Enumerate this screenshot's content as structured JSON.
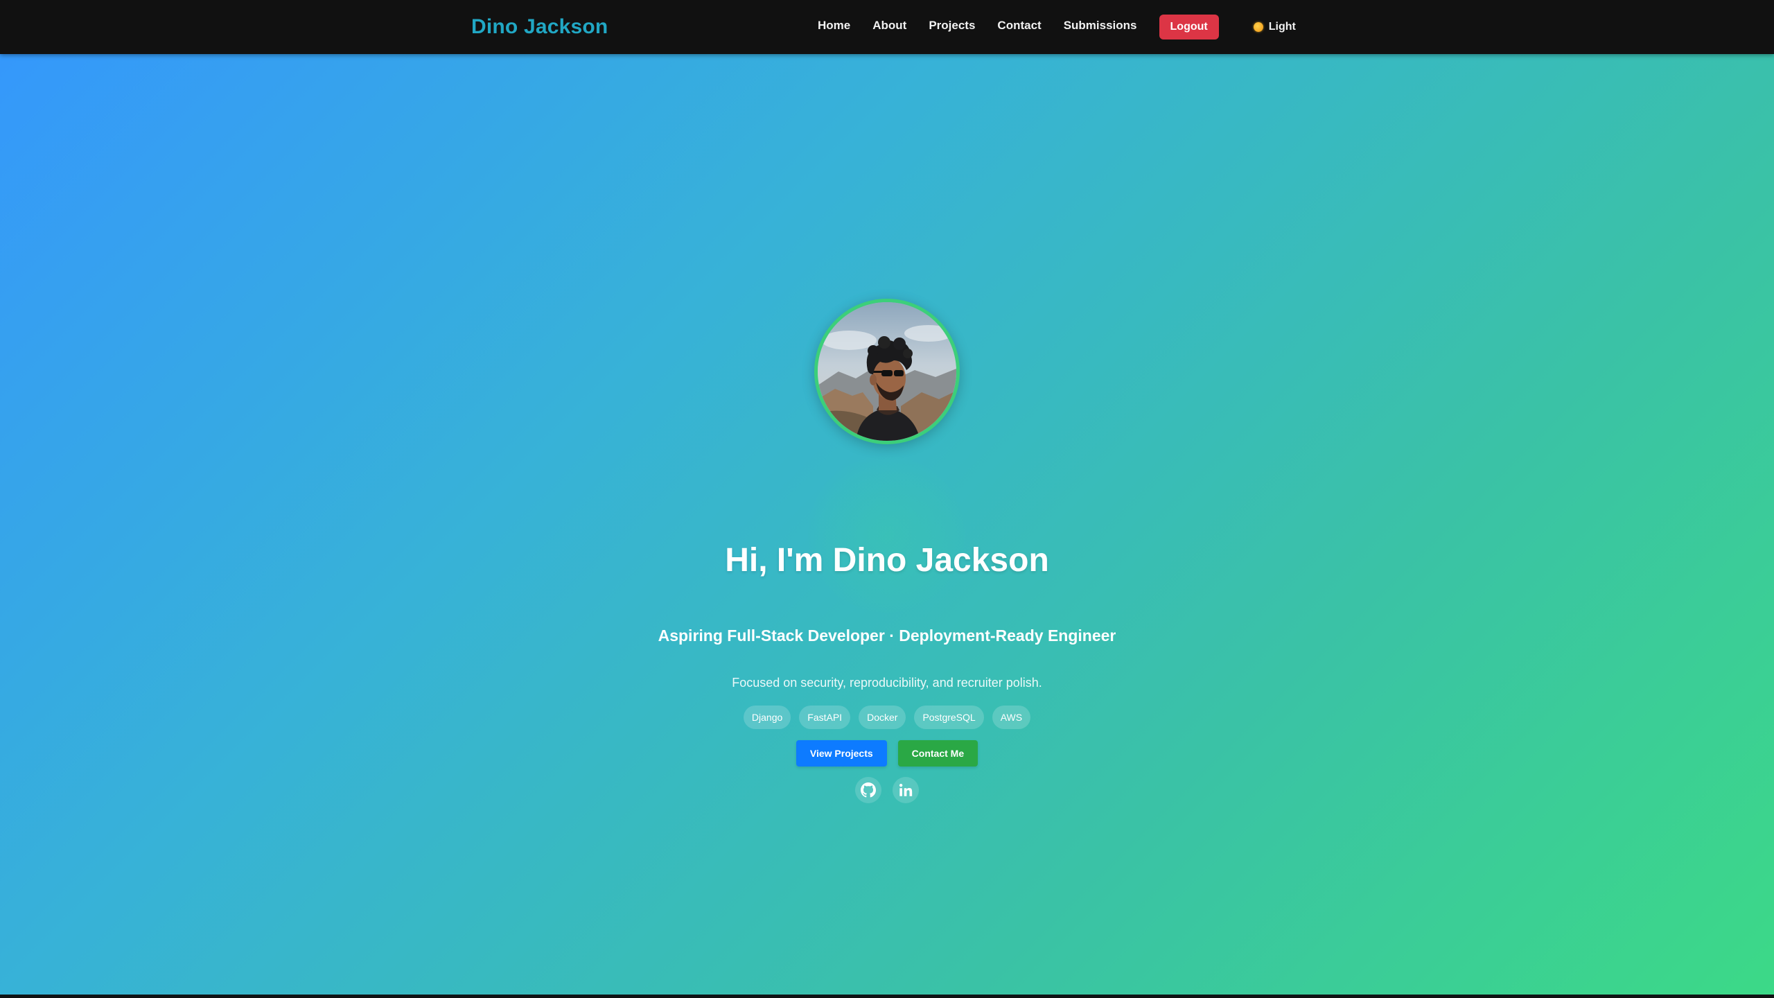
{
  "brand": {
    "name": "Dino Jackson"
  },
  "nav": {
    "links": [
      "Home",
      "About",
      "Projects",
      "Contact",
      "Submissions"
    ],
    "logout_label": "Logout",
    "theme_label": "Light",
    "theme_icon": "sun-icon"
  },
  "hero": {
    "title": "Hi, I'm Dino Jackson",
    "subtitle": "Aspiring Full-Stack Developer · Deployment-Ready Engineer",
    "description": "Focused on security, reproducibility, and recruiter polish.",
    "tags": [
      "Django",
      "FastAPI",
      "Docker",
      "PostgreSQL",
      "AWS"
    ],
    "buttons": {
      "primary": "View Projects",
      "secondary": "Contact Me"
    },
    "socials": [
      "github-icon",
      "linkedin-icon"
    ]
  },
  "colors": {
    "navbar_bg": "#111111",
    "brand": "#21a7c4",
    "logout": "#dc3545",
    "primary": "#0d7bff",
    "success": "#2aa845",
    "avatar_border": "#3ccf7a",
    "gradient_start": "#3598fb",
    "gradient_end": "#3cd987"
  }
}
